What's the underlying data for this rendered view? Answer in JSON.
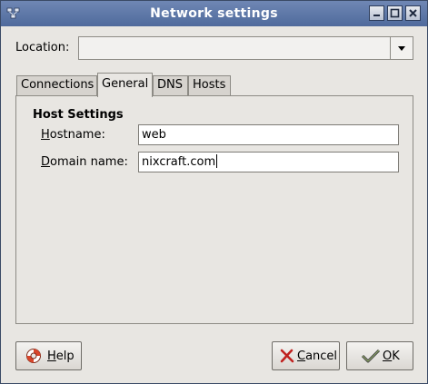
{
  "window": {
    "title": "Network settings"
  },
  "location": {
    "label": "Location:",
    "value": ""
  },
  "tabs": [
    {
      "label": "Connections",
      "active": false
    },
    {
      "label": "General",
      "active": true
    },
    {
      "label": "DNS",
      "active": false
    },
    {
      "label": "Hosts",
      "active": false
    }
  ],
  "general": {
    "section_title": "Host Settings",
    "hostname_label_u": "H",
    "hostname_label_rest": "ostname:",
    "hostname_value": "web",
    "domain_label_u": "D",
    "domain_label_rest": "omain name:",
    "domain_value": "nixcraft.com"
  },
  "buttons": {
    "help_u": "H",
    "help_rest": "elp",
    "cancel_u": "C",
    "cancel_rest": "ancel",
    "ok_u": "O",
    "ok_rest": "K"
  },
  "colors": {
    "titlebar": "#5b76a8",
    "background": "#e8e6e2"
  },
  "icons": {
    "window_menu": "window-menu-icon",
    "minimize": "minimize-icon",
    "maximize": "maximize-icon",
    "close": "close-icon",
    "help": "lifebuoy-icon",
    "cancel": "cross-icon",
    "ok": "check-icon"
  }
}
